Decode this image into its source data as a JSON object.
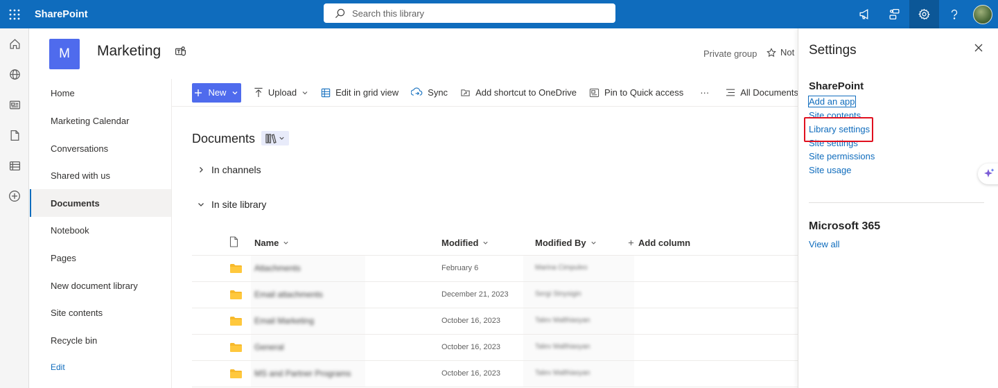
{
  "suite": {
    "app_name": "SharePoint",
    "search_placeholder": "Search this library"
  },
  "site": {
    "logo_letter": "M",
    "title": "Marketing",
    "privacy": "Private group",
    "follow_label": "Not"
  },
  "nav": {
    "items": [
      "Home",
      "Marketing Calendar",
      "Conversations",
      "Shared with us",
      "Documents",
      "Notebook",
      "Pages",
      "New document library",
      "Site contents",
      "Recycle bin"
    ],
    "selected": "Documents",
    "edit_label": "Edit"
  },
  "commands": {
    "new_label": "New",
    "upload": "Upload",
    "grid_view": "Edit in grid view",
    "sync": "Sync",
    "shortcut": "Add shortcut to OneDrive",
    "pin": "Pin to Quick access",
    "more": "···",
    "all_docs": "All Documents"
  },
  "library": {
    "title": "Documents",
    "groups": [
      "In channels",
      "In site library"
    ],
    "columns": {
      "name": "Name",
      "modified": "Modified",
      "modified_by": "Modified By",
      "add_column": "Add column"
    },
    "rows": [
      {
        "name": "Attachments",
        "modified": "February 6",
        "modified_by": "Marina Cimpuleo"
      },
      {
        "name": "Email attachments",
        "modified": "December 21, 2023",
        "modified_by": "Sergi Stnysigin"
      },
      {
        "name": "Email Marketing",
        "modified": "October 16, 2023",
        "modified_by": "Talev Malthiasyan"
      },
      {
        "name": "General",
        "modified": "October 16, 2023",
        "modified_by": "Talev Malthiasyan"
      },
      {
        "name": "MS and Partner Programs",
        "modified": "October 16, 2023",
        "modified_by": "Talev Malthiasyan"
      }
    ]
  },
  "settings": {
    "title": "Settings",
    "sharepoint_section": "SharePoint",
    "links": [
      "Add an app",
      "Site contents",
      "Library settings",
      "Site settings",
      "Site permissions",
      "Site usage"
    ],
    "ms365_section": "Microsoft 365",
    "view_all": "View all"
  },
  "colors": {
    "suite_bar": "#0f6cbd",
    "accent": "#4f6bed",
    "highlight_box": "#e0101f",
    "link": "#0f6cbd"
  }
}
